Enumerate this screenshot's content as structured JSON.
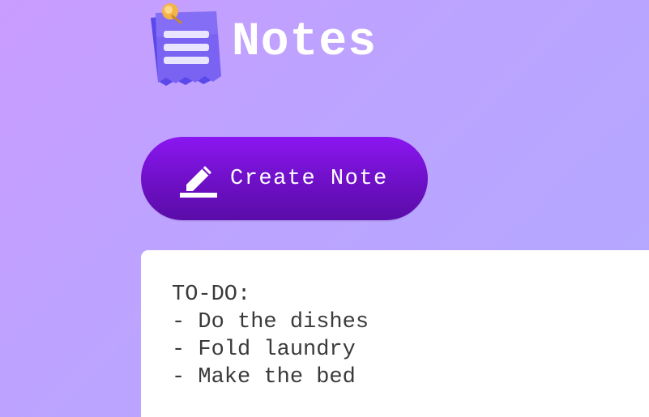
{
  "header": {
    "icon": "notes-app-icon",
    "title": "Notes"
  },
  "actions": {
    "create_icon": "pencil-icon",
    "create_label": "Create Note"
  },
  "notes": [
    {
      "lines": [
        "TO-DO:",
        "- Do the dishes",
        "- Fold laundry",
        "- Make the bed"
      ]
    }
  ],
  "colors": {
    "background_start": "#c99cff",
    "background_end": "#b3a8ff",
    "button": "#7a12dc",
    "card": "#ffffff",
    "text": "#3a3a3a"
  }
}
